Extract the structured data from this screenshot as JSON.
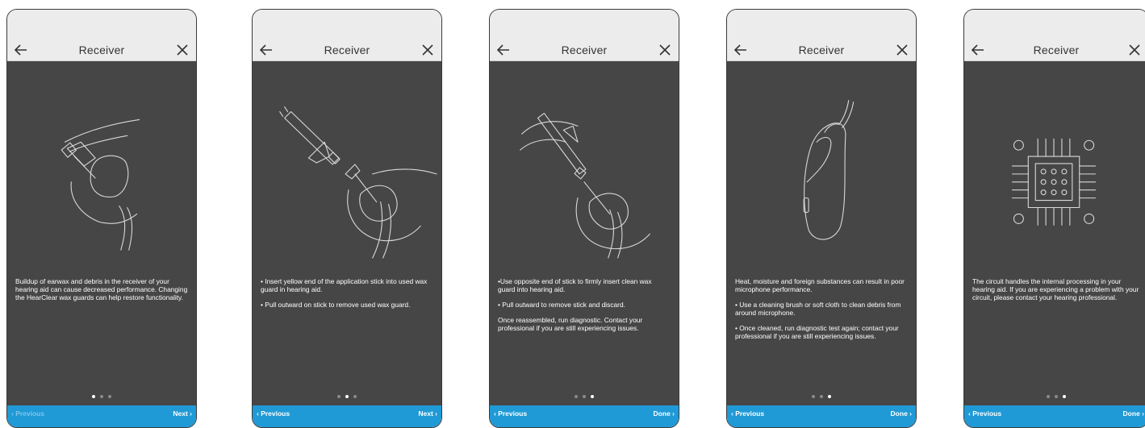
{
  "screens": [
    {
      "header": {
        "title": "Receiver",
        "back_icon": "arrow-left-icon",
        "close_icon": "close-icon"
      },
      "paragraphs": [
        "Buildup of earwax and debris in the receiver of your hearing aid can cause decreased performance. Changing the HearClear wax guards can help restore functionality."
      ],
      "pagination": {
        "current": 1,
        "total": 3
      },
      "footer": {
        "previous": "‹ Previous",
        "next": "Next ›",
        "previous_enabled": false
      }
    },
    {
      "header": {
        "title": "Receiver",
        "back_icon": "arrow-left-icon",
        "close_icon": "close-icon"
      },
      "paragraphs": [
        "• Insert yellow end of the application stick into used wax guard in hearing aid.",
        "• Pull outward on stick to remove used wax guard."
      ],
      "pagination": {
        "current": 2,
        "total": 3
      },
      "footer": {
        "previous": "‹ Previous",
        "next": "Next ›",
        "previous_enabled": true
      }
    },
    {
      "header": {
        "title": "Receiver",
        "back_icon": "arrow-left-icon",
        "close_icon": "close-icon"
      },
      "paragraphs": [
        "•Use opposite end of stick to firmly insert clean wax guard into hearing aid.",
        "• Pull outward to remove stick and discard.",
        "Once reassembled, run diagnostic. Contact your professional if you are still experiencing issues."
      ],
      "pagination": {
        "current": 3,
        "total": 3
      },
      "footer": {
        "previous": "‹ Previous",
        "next": "Done ›",
        "previous_enabled": true
      }
    },
    {
      "header": {
        "title": "Receiver",
        "back_icon": "arrow-left-icon",
        "close_icon": "close-icon"
      },
      "paragraphs": [
        "Heat, moisture and foreign substances can result in poor microphone performance.",
        "• Use a cleaning brush or soft cloth to clean debris from around microphone.",
        "• Once cleaned, run diagnostic test again; contact your professional if you are still experiencing issues."
      ],
      "pagination": {
        "current": 3,
        "total": 3
      },
      "footer": {
        "previous": "‹ Previous",
        "next": "Done ›",
        "previous_enabled": true
      }
    },
    {
      "header": {
        "title": "Receiver",
        "back_icon": "arrow-left-icon",
        "close_icon": "close-icon"
      },
      "paragraphs": [
        "The circuit handles the internal processing in your hearing aid. If you are experiencing a problem with your circuit, please contact your hearing professional."
      ],
      "pagination": {
        "current": 3,
        "total": 3
      },
      "footer": {
        "previous": "‹ Previous",
        "next": "Done ›",
        "previous_enabled": true
      }
    }
  ],
  "colors": {
    "header_bg": "#ececec",
    "content_bg": "#464646",
    "footer_bg": "#1f9ad6",
    "text": "#ffffff"
  }
}
